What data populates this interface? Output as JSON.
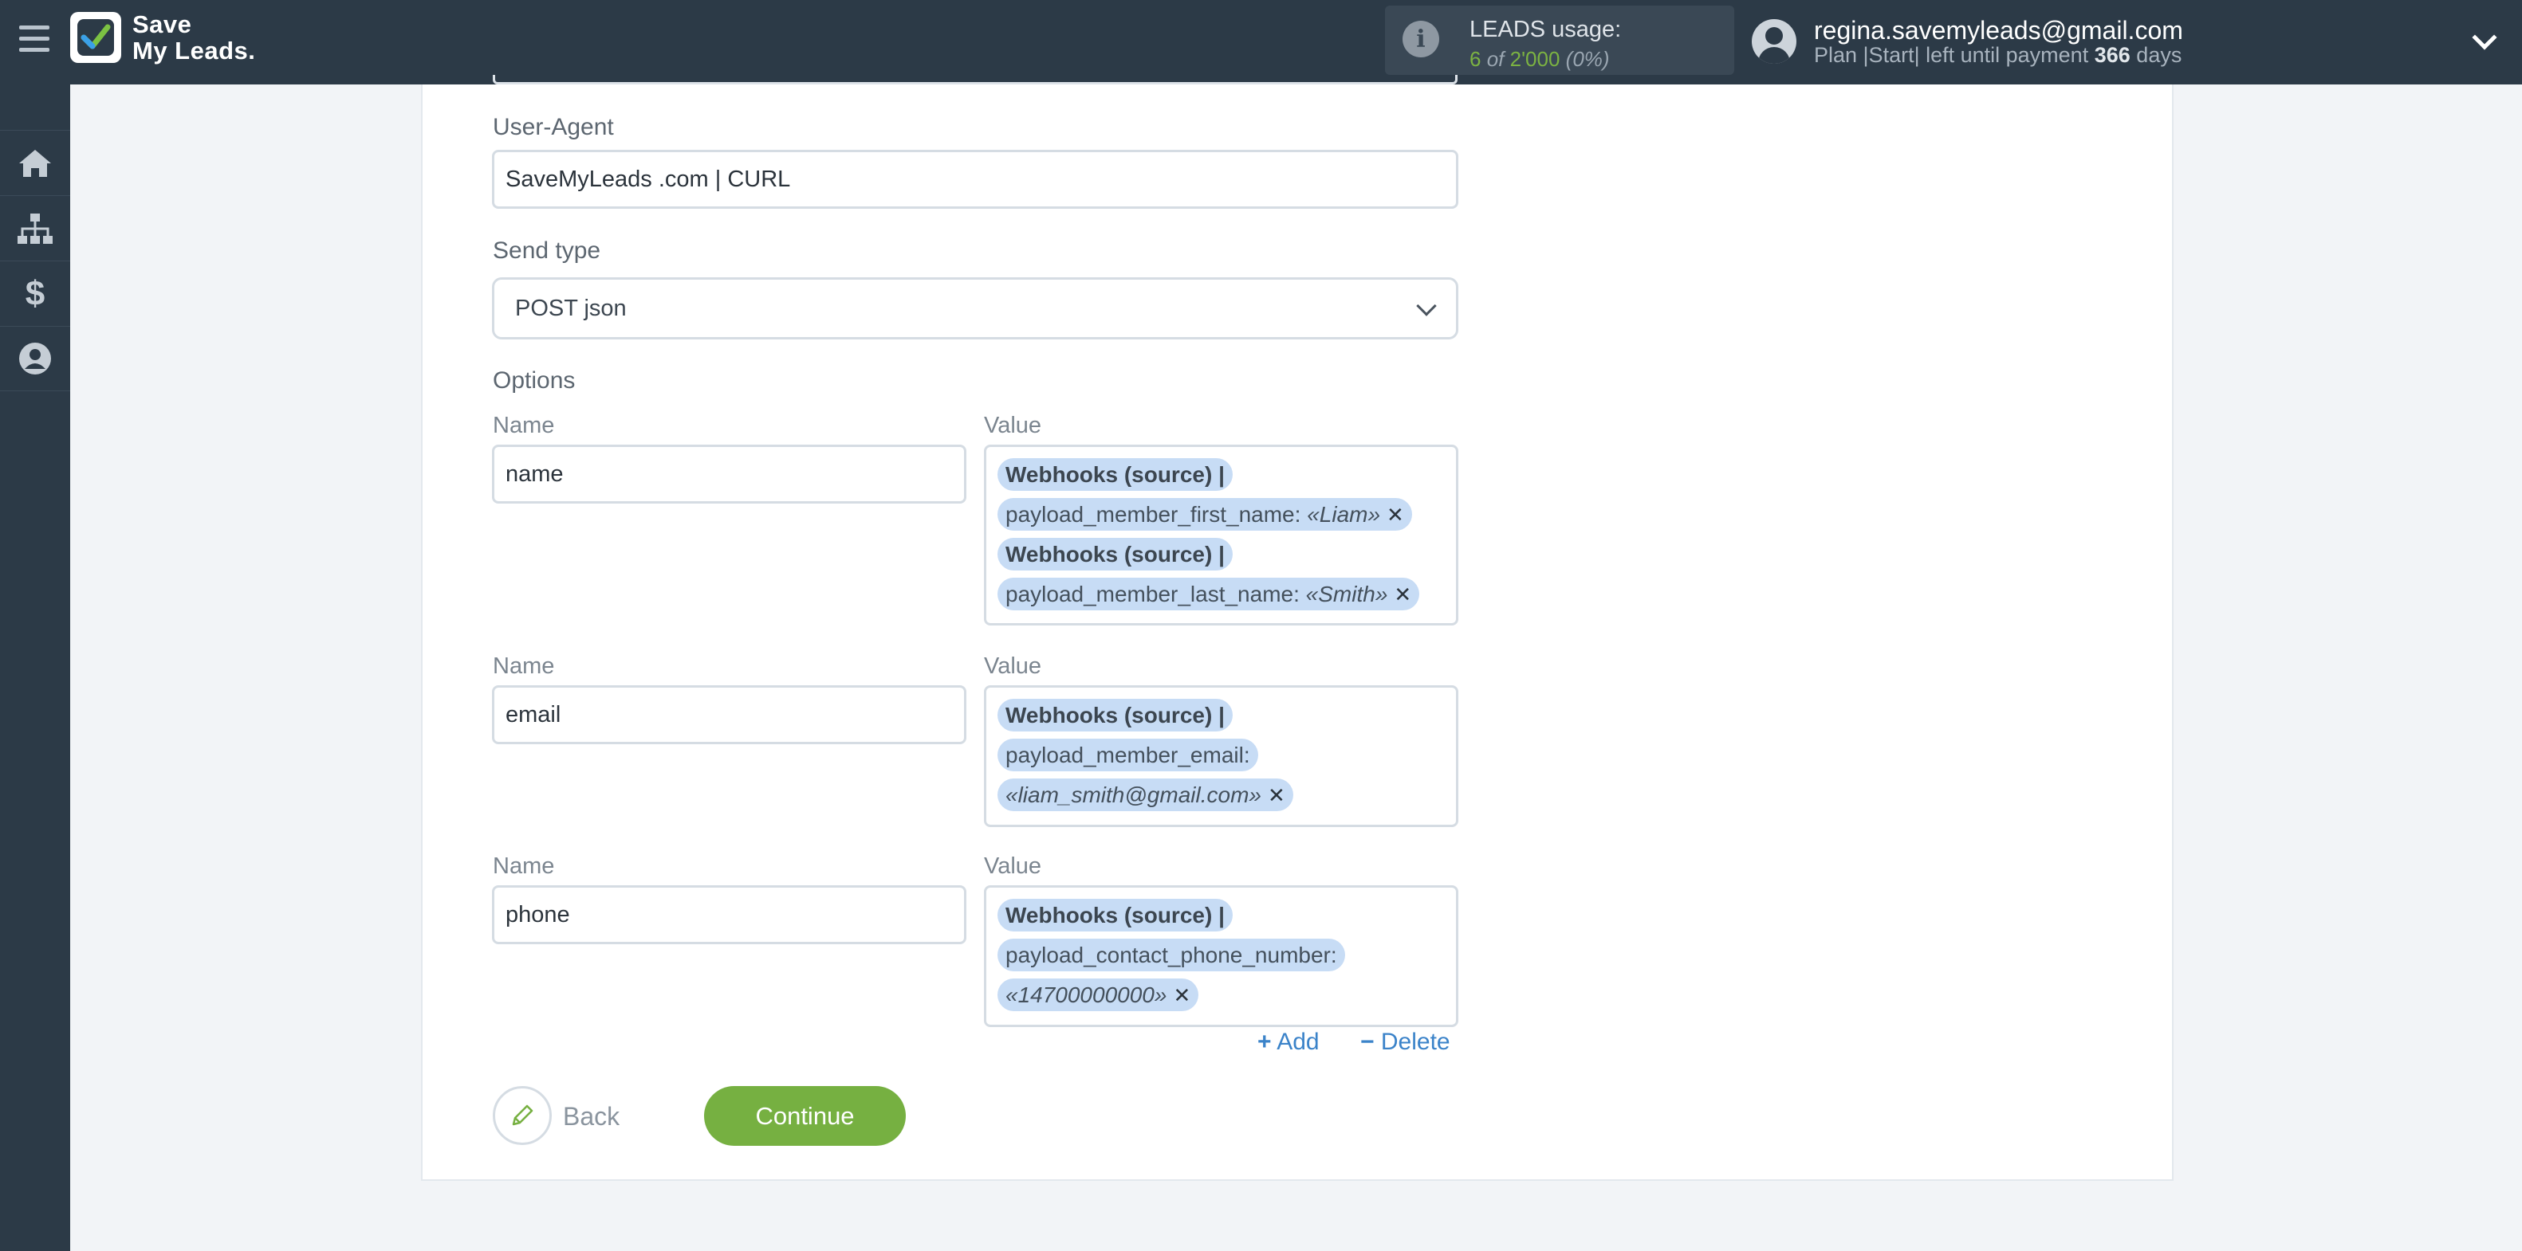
{
  "app": {
    "logo_line1": "Save",
    "logo_line2": "My Leads."
  },
  "header": {
    "usage_label": "LEADS usage:",
    "usage_used": "6",
    "usage_of": "of",
    "usage_total": "2'000",
    "usage_percent": "(0%)",
    "user_email": "regina.savemyleads@gmail.com",
    "plan_text": "Plan |Start| left until payment",
    "plan_days": "366",
    "plan_days_unit": "days"
  },
  "sidebar": {
    "items": [
      {
        "icon": "home-icon"
      },
      {
        "icon": "sitemap-icon"
      },
      {
        "icon": "dollar-icon"
      },
      {
        "icon": "user-circle-icon"
      }
    ]
  },
  "form": {
    "user_agent_label": "User-Agent",
    "user_agent_value": "SaveMyLeads .com | CURL",
    "send_type_label": "Send type",
    "send_type_value": "POST json",
    "options_label": "Options",
    "name_col": "Name",
    "value_col": "Value",
    "options": [
      {
        "name": "name",
        "tags": [
          {
            "source": "Webhooks (source) |",
            "field": "payload_member_first_name:",
            "value": "«Liam»"
          },
          {
            "source": "Webhooks (source) |",
            "field": "payload_member_last_name:",
            "value": "«Smith»"
          }
        ]
      },
      {
        "name": "email",
        "tags": [
          {
            "source": "Webhooks (source) |",
            "field": "payload_member_email:",
            "value": "«liam_smith@gmail.com»"
          }
        ]
      },
      {
        "name": "phone",
        "tags": [
          {
            "source": "Webhooks (source) |",
            "field": "payload_contact_phone_number:",
            "value": "«14700000000»"
          }
        ]
      }
    ],
    "add_label": "Add",
    "delete_label": "Delete",
    "back_label": "Back",
    "continue_label": "Continue"
  },
  "colors": {
    "topbar": "#2c3a47",
    "accent_green": "#76b041",
    "link_blue": "#3b83c9",
    "tag_highlight": "#c7dcf5"
  }
}
